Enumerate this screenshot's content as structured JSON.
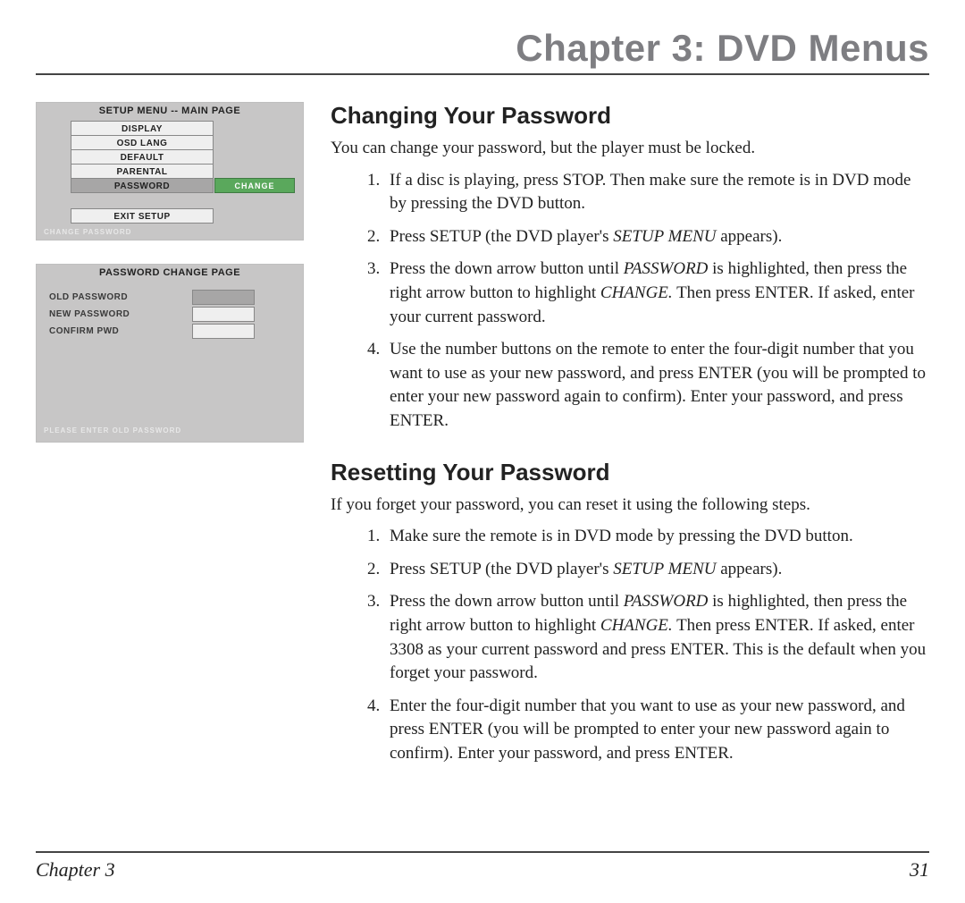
{
  "header": {
    "title": "Chapter 3: DVD Menus"
  },
  "figure1": {
    "title": "SETUP MENU -- MAIN PAGE",
    "items": [
      "DISPLAY",
      "OSD LANG",
      "DEFAULT",
      "PARENTAL",
      "PASSWORD"
    ],
    "sub": "CHANGE",
    "exit": "EXIT SETUP",
    "footer": "CHANGE PASSWORD"
  },
  "figure2": {
    "title": "PASSWORD CHANGE PAGE",
    "rows": [
      "OLD PASSWORD",
      "NEW PASSWORD",
      "CONFIRM PWD"
    ],
    "footer": "PLEASE ENTER OLD PASSWORD"
  },
  "section1": {
    "heading": "Changing Your Password",
    "lead": "You can change your password, but the player must be locked.",
    "steps": [
      "If a disc is playing, press STOP.  Then make sure the remote is in DVD mode by pressing the DVD button.",
      "Press SETUP (the DVD player's SETUP MENU appears).",
      "Press the down arrow button until PASSWORD is highlighted, then press the right arrow button to highlight CHANGE. Then press ENTER. If asked, enter your current password.",
      "Use the number buttons on the remote to enter the four-digit number that you want to use as your new password, and press ENTER (you will be prompted to enter your new password again to confirm). Enter your password, and press ENTER."
    ]
  },
  "section2": {
    "heading": "Resetting Your Password",
    "lead": "If you forget your password, you can reset it using the following steps.",
    "steps": [
      "Make sure the remote is in DVD mode by pressing the DVD button.",
      "Press SETUP (the DVD player's SETUP MENU appears).",
      "Press the down arrow button until PASSWORD is highlighted, then press the right arrow button to highlight CHANGE. Then press ENTER. If asked, enter 3308 as your current password and press ENTER. This is the default when you forget your password.",
      "Enter the four-digit number that you want to use as your new password, and press ENTER (you will be prompted to enter your new password again to confirm). Enter your password, and press ENTER."
    ]
  },
  "footer": {
    "chapter": "Chapter 3",
    "page": "31"
  }
}
